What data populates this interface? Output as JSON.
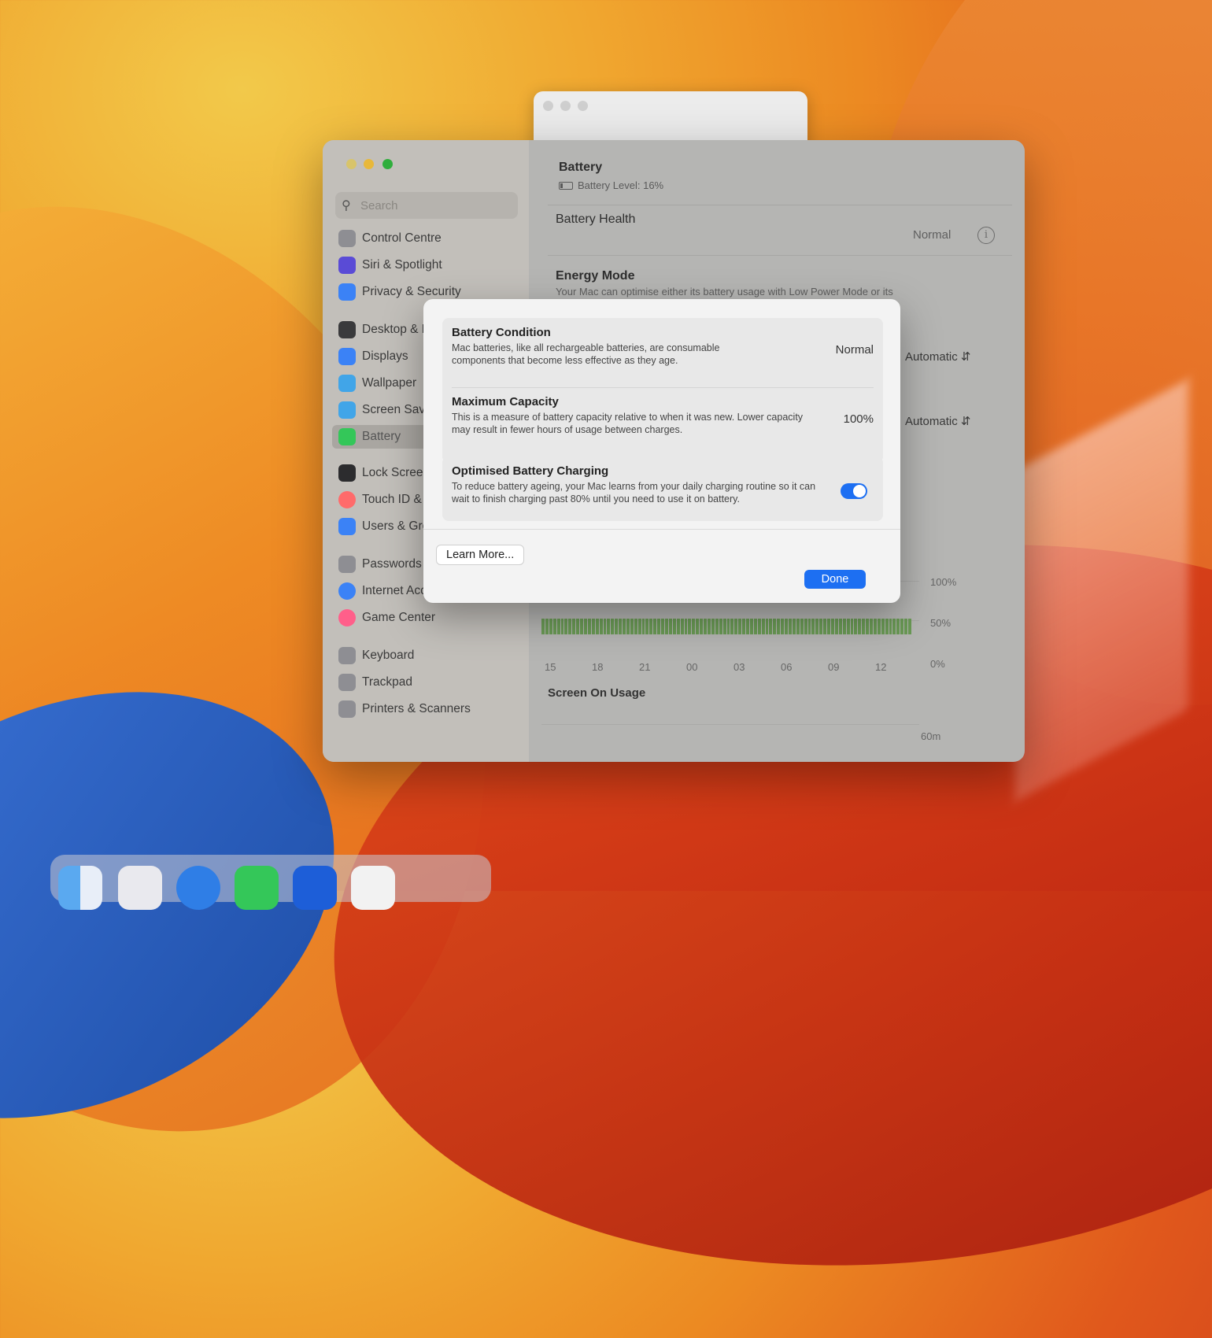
{
  "back_window": {},
  "sidebar": {
    "search_placeholder": "Search",
    "items": [
      {
        "label": "Control Centre",
        "color": "#8e8e93"
      },
      {
        "label": "Siri & Spotlight",
        "color": "#5a4bd6"
      },
      {
        "label": "Privacy & Security",
        "color": "#3b82f6"
      },
      {
        "label": "Desktop & Dock",
        "color": "#3a3a3c"
      },
      {
        "label": "Displays",
        "color": "#3b82f6"
      },
      {
        "label": "Wallpaper",
        "color": "#41a5e8"
      },
      {
        "label": "Screen Saver",
        "color": "#41a5e8"
      },
      {
        "label": "Battery",
        "color": "#34c759"
      },
      {
        "label": "Lock Screen",
        "color": "#2c2c2e"
      },
      {
        "label": "Touch ID & Password",
        "color": "#ff6b6b"
      },
      {
        "label": "Users & Groups",
        "color": "#3b82f6"
      },
      {
        "label": "Passwords",
        "color": "#8e8e93"
      },
      {
        "label": "Internet Accounts",
        "color": "#3b82f6"
      },
      {
        "label": "Game Center",
        "color": "#ff5f8a"
      },
      {
        "label": "Keyboard",
        "color": "#8e8e93"
      },
      {
        "label": "Trackpad",
        "color": "#8e8e93"
      },
      {
        "label": "Printers & Scanners",
        "color": "#8e8e93"
      }
    ]
  },
  "main": {
    "title": "Battery",
    "battery_level": "Battery Level: 16%",
    "battery_health_label": "Battery Health",
    "battery_health_value": "Normal",
    "energy_mode_label": "Energy Mode",
    "energy_mode_desc": "Your Mac can optimise either its battery usage with Low Power Mode or its performance in resource-intensive tasks with High Power Mode.",
    "energy_select_1": "Automatic",
    "energy_select_2": "Automatic",
    "chart": {
      "y_ticks": [
        "100%",
        "50%",
        "0%"
      ],
      "x_ticks": [
        "15",
        "18",
        "21",
        "00",
        "03",
        "06",
        "09",
        "12"
      ],
      "section_title": "Screen On Usage",
      "usage_tick": "60m"
    }
  },
  "dialog": {
    "condition_title": "Battery Condition",
    "condition_desc": "Mac batteries, like all rechargeable batteries, are consumable components that become less effective as they age.",
    "condition_value": "Normal",
    "capacity_title": "Maximum Capacity",
    "capacity_desc": "This is a measure of battery capacity relative to when it was new. Lower capacity may result in fewer hours of usage between charges.",
    "capacity_value": "100%",
    "optimised_title": "Optimised Battery Charging",
    "optimised_desc": "To reduce battery ageing, your Mac learns from your daily charging routine so it can wait to finish charging past 80% until you need to use it on battery.",
    "optimised_enabled": true,
    "learn_more": "Learn More...",
    "done": "Done"
  },
  "colors": {
    "accent": "#1d6ff2",
    "traffic_close": "#ff5f57",
    "traffic_min": "#febc2e",
    "traffic_max": "#28c840"
  }
}
